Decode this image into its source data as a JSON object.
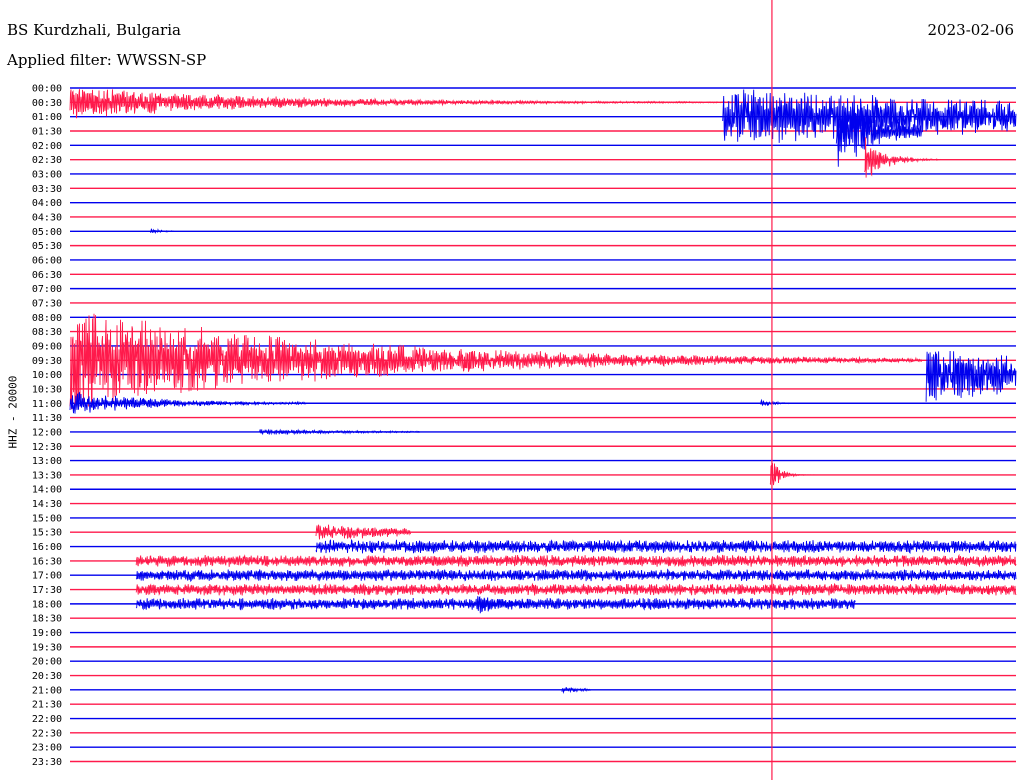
{
  "header": {
    "station": "BS Kurdzhali, Bulgaria",
    "filter": "Applied filter: WWSSN-SP",
    "date": "2023-02-06"
  },
  "colors": {
    "blue": "#0000ee",
    "red": "#ff1a4b",
    "background": "#ffffff",
    "text": "#000000"
  },
  "chart_data": {
    "type": "line",
    "title": "BS Kurdzhali, Bulgaria",
    "subtitle": "Applied filter: WWSSN-SP",
    "ylabel": "HHZ - 20000",
    "grid": false,
    "row_labels": [
      "00:00",
      "00:30",
      "01:00",
      "01:30",
      "02:00",
      "02:30",
      "03:00",
      "03:30",
      "04:00",
      "04:30",
      "05:00",
      "05:30",
      "06:00",
      "06:30",
      "07:00",
      "07:30",
      "08:00",
      "08:30",
      "09:00",
      "09:30",
      "10:00",
      "10:30",
      "11:00",
      "11:30",
      "12:00",
      "12:30",
      "13:00",
      "13:30",
      "14:00",
      "14:30",
      "15:00",
      "15:30",
      "16:00",
      "16:30",
      "17:00",
      "17:30",
      "18:00",
      "18:30",
      "19:00",
      "19:30",
      "20:00",
      "20:30",
      "21:00",
      "21:30",
      "22:00",
      "22:30",
      "23:00",
      "23:30"
    ],
    "row_colors": [
      "blue",
      "red"
    ],
    "events": [
      {
        "row": 1,
        "x_start": 0.0,
        "x_end": 0.7,
        "amplitude": 18,
        "decay": 3.5,
        "color": "red"
      },
      {
        "row": 2,
        "x_start": 0.69,
        "x_end": 1.0,
        "amplitude": 30,
        "decay": 0.6,
        "color": "blue"
      },
      {
        "row": 3,
        "x_start": 0.81,
        "x_end": 0.9,
        "amplitude": 40,
        "decay": 1.8,
        "color": "blue"
      },
      {
        "row": 5,
        "x_start": 0.84,
        "x_end": 0.92,
        "amplitude": 26,
        "decay": 4.0,
        "color": "red"
      },
      {
        "row": 10,
        "x_start": 0.085,
        "x_end": 0.11,
        "amplitude": 3,
        "decay": 2.0,
        "color": "blue"
      },
      {
        "row": 19,
        "x_start": 0.0,
        "x_end": 0.9,
        "amplitude": 55,
        "decay": 3.2,
        "color": "red"
      },
      {
        "row": 20,
        "x_start": 0.905,
        "x_end": 1.0,
        "amplitude": 30,
        "decay": 0.5,
        "color": "blue"
      },
      {
        "row": 22,
        "x_start": 0.0,
        "x_end": 0.25,
        "amplitude": 12,
        "decay": 2.5,
        "color": "blue"
      },
      {
        "row": 22,
        "x_start": 0.73,
        "x_end": 0.76,
        "amplitude": 4,
        "decay": 2.0,
        "color": "blue"
      },
      {
        "row": 24,
        "x_start": 0.2,
        "x_end": 0.37,
        "amplitude": 3,
        "decay": 1.5,
        "color": "blue"
      },
      {
        "row": 27,
        "x_start": 0.74,
        "x_end": 0.79,
        "amplitude": 26,
        "decay": 6.0,
        "color": "red"
      },
      {
        "row": 31,
        "x_start": 0.26,
        "x_end": 0.36,
        "amplitude": 9,
        "decay": 0.8,
        "color": "red"
      },
      {
        "row": 32,
        "x_start": 0.26,
        "x_end": 1.0,
        "amplitude": 7,
        "decay": 0.1,
        "color": "blue"
      },
      {
        "row": 33,
        "x_start": 0.07,
        "x_end": 1.0,
        "amplitude": 6,
        "decay": 0.0,
        "color": "red"
      },
      {
        "row": 34,
        "x_start": 0.07,
        "x_end": 1.0,
        "amplitude": 6,
        "decay": 0.0,
        "color": "blue"
      },
      {
        "row": 35,
        "x_start": 0.07,
        "x_end": 1.0,
        "amplitude": 6,
        "decay": 0.0,
        "color": "red"
      },
      {
        "row": 36,
        "x_start": 0.07,
        "x_end": 0.83,
        "amplitude": 6,
        "decay": 0.0,
        "color": "blue"
      },
      {
        "row": 36,
        "x_start": 0.43,
        "x_end": 0.48,
        "amplitude": 12,
        "decay": 1.5,
        "color": "blue"
      },
      {
        "row": 42,
        "x_start": 0.52,
        "x_end": 0.55,
        "amplitude": 3,
        "decay": 1.0,
        "color": "blue"
      }
    ],
    "marker_line": {
      "x_fraction": 0.742,
      "color": "red"
    }
  }
}
